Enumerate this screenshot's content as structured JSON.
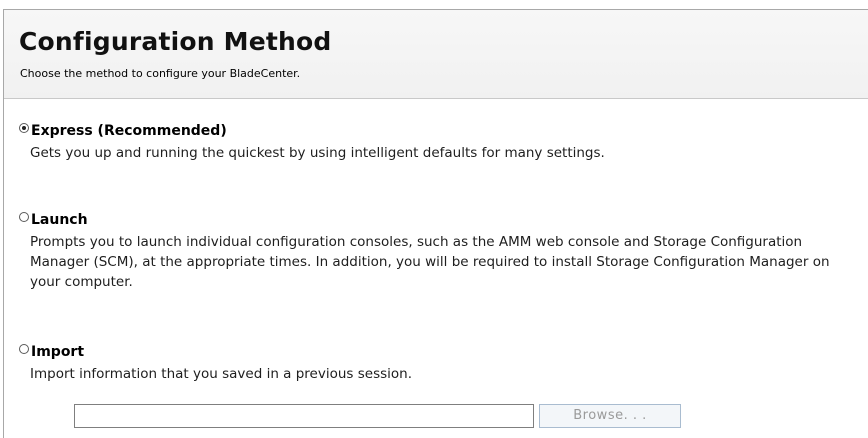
{
  "header": {
    "title": "Configuration Method",
    "subtitle": "Choose the method to configure your BladeCenter."
  },
  "options": [
    {
      "label": "Express (Recommended)",
      "description": "Gets you up and running the quickest by using intelligent defaults for many settings.",
      "selected": true
    },
    {
      "label": "Launch",
      "description": "Prompts you to launch individual configuration consoles, such as the AMM web console and Storage Configuration Manager (SCM), at the appropriate times. In addition, you will be required to install Storage Configuration Manager on your computer.",
      "selected": false
    },
    {
      "label": "Import",
      "description": "Import information that you saved in a previous session.",
      "selected": false
    }
  ],
  "import_file": {
    "value": "",
    "browse_label": "Browse. . .",
    "browse_enabled": false
  },
  "colors": {
    "header_background": "#f4f4f4",
    "header_border": "#c9c9c9",
    "disabled_text": "#9a9a9a",
    "button_border": "#a9bcd0"
  }
}
